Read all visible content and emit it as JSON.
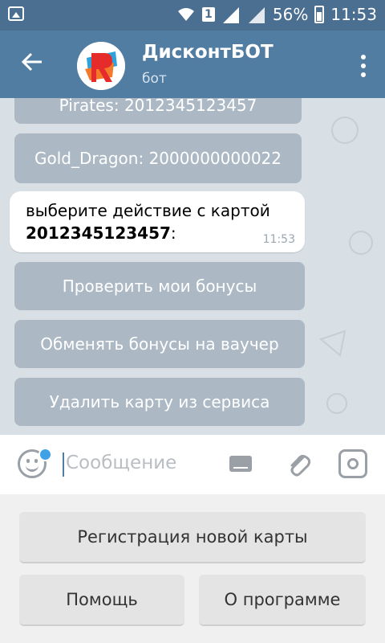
{
  "status_bar": {
    "sim_slot": "1",
    "battery_percent": "56%",
    "time": "11:53"
  },
  "header": {
    "title": "ДисконтБОТ",
    "subtitle": "бот"
  },
  "chat": {
    "top_buttons": [
      "Pirates: 2012345123457",
      "Gold_Dragon: 2000000000022"
    ],
    "message": {
      "line1": "выберите действие с картой",
      "card_number": "2012345123457",
      "colon": ":",
      "time": "11:53"
    },
    "action_buttons": [
      "Проверить мои бонусы",
      "Обменять бонусы на ваучер",
      "Удалить карту из сервиса"
    ]
  },
  "input": {
    "placeholder": "Сообщение"
  },
  "reply_keyboard": {
    "row1": "Регистрация новой карты",
    "row2_left": "Помощь",
    "row2_right": "О программе"
  },
  "colors": {
    "header": "#527da3",
    "statusbar": "#4b6f91",
    "accent_dot": "#3fa1e6"
  }
}
